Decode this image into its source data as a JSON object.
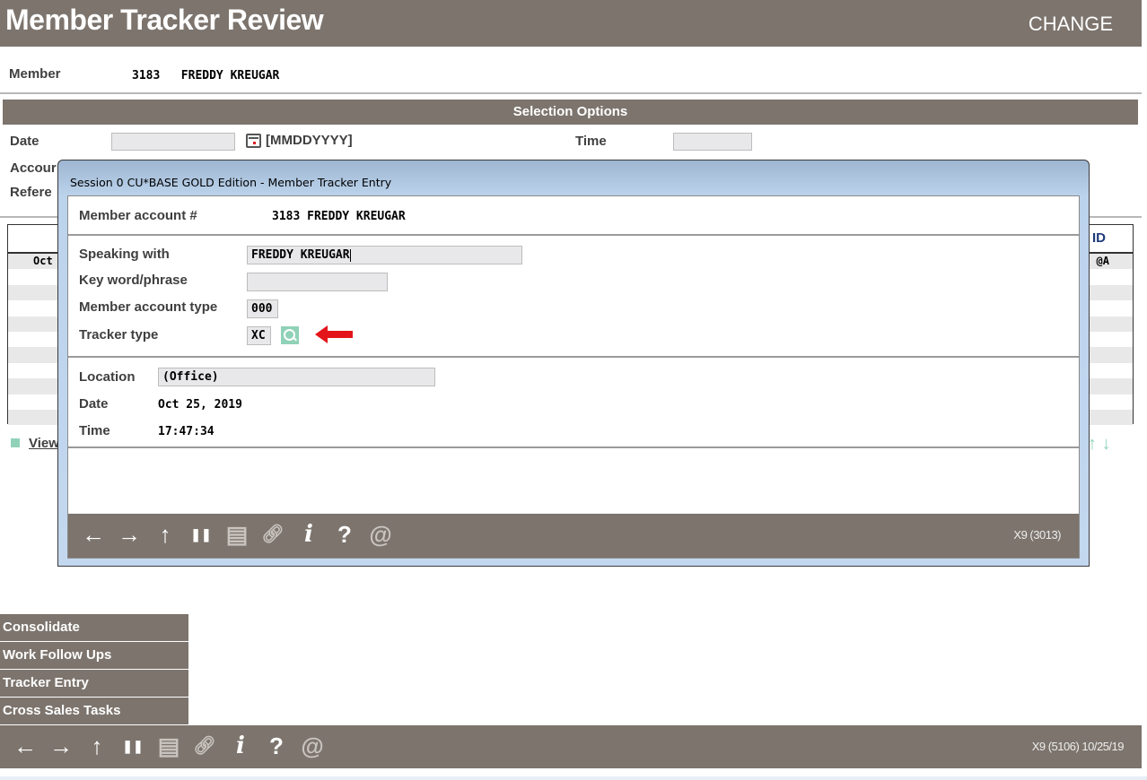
{
  "header": {
    "title": "Member Tracker Review",
    "mode": "CHANGE"
  },
  "member": {
    "label": "Member",
    "account": "3183",
    "name": "FREDDY KREUGAR"
  },
  "selection": {
    "title": "Selection Options",
    "date_label": "Date",
    "date_value": "",
    "date_format": "[MMDDYYYY]",
    "time_label": "Time",
    "time_value": "",
    "account_label": "Accour",
    "reference_label": "Refere"
  },
  "grid": {
    "id_header": "ID",
    "rows": [
      {
        "col1": "Oct",
        "id": "@A"
      },
      {
        "col1": "",
        "id": ""
      },
      {
        "col1": "",
        "id": ""
      },
      {
        "col1": "",
        "id": ""
      },
      {
        "col1": "",
        "id": ""
      },
      {
        "col1": "",
        "id": ""
      },
      {
        "col1": "",
        "id": ""
      },
      {
        "col1": "",
        "id": ""
      },
      {
        "col1": "",
        "id": ""
      },
      {
        "col1": "",
        "id": ""
      }
    ],
    "view_link": "View",
    "scroll_up": "↑",
    "scroll_down": "↓"
  },
  "menu": {
    "items": [
      "Consolidate",
      "Work Follow Ups",
      "Tracker Entry",
      "Cross Sales Tasks"
    ]
  },
  "toolbar": {
    "icons": [
      {
        "name": "back-arrow-icon",
        "glyph": "←"
      },
      {
        "name": "forward-arrow-icon",
        "glyph": "→"
      },
      {
        "name": "up-arrow-icon",
        "glyph": "↑"
      },
      {
        "name": "pause-icon",
        "glyph": "❚❚"
      },
      {
        "name": "print-icon",
        "glyph": "▤"
      },
      {
        "name": "link-icon",
        "glyph": "🔗︎"
      },
      {
        "name": "info-icon",
        "glyph": "𝒊"
      },
      {
        "name": "help-icon",
        "glyph": "?"
      },
      {
        "name": "email-icon",
        "glyph": "@"
      }
    ]
  },
  "footer": {
    "status": "X9 (5106) 10/25/19"
  },
  "dialog": {
    "title": "Session 0 CU*BASE GOLD Edition - Member Tracker Entry",
    "member_account_label": "Member account #",
    "member_account_value": "3183 FREDDY KREUGAR",
    "speaking_with_label": "Speaking with",
    "speaking_with_value": "FREDDY KREUGAR",
    "keyword_label": "Key word/phrase",
    "keyword_value": "",
    "account_type_label": "Member account type",
    "account_type_value": "000",
    "tracker_type_label": "Tracker type",
    "tracker_type_value": "XC",
    "location_label": "Location",
    "location_value": "(Office)",
    "date_label": "Date",
    "date_value": "Oct 25, 2019",
    "time_label": "Time",
    "time_value": "17:47:34",
    "status": "X9 (3013)",
    "annotation_color": "#e3151b",
    "accent_color": "#8fd2b8"
  }
}
